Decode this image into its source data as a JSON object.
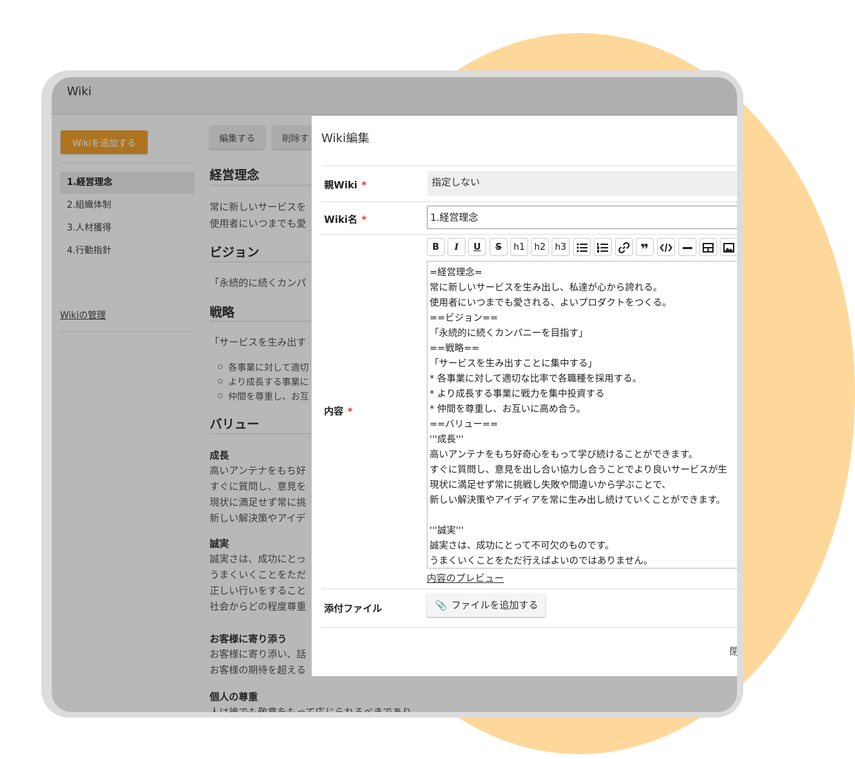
{
  "app": {
    "title": "Wiki"
  },
  "sidebar": {
    "add_label": "Wikiを追加する",
    "items": [
      {
        "label": "1.経営理念",
        "active": true
      },
      {
        "label": "2.組織体制",
        "active": false
      },
      {
        "label": "3.人材獲得",
        "active": false
      },
      {
        "label": "4.行動指針",
        "active": false
      }
    ],
    "manage_label": "Wikiの管理"
  },
  "page": {
    "edit_label": "編集する",
    "delete_label": "削除す",
    "sections": {
      "title": "経営理念",
      "intro": [
        "常に新しいサービスを",
        "使用者にいつまでも愛"
      ],
      "vision_heading": "ビジョン",
      "vision_text": "「永続的に続くカンパ",
      "strategy_heading": "戦略",
      "strategy_text": "「サービスを生み出す",
      "strategy_items": [
        "各事業に対して適切",
        "より成長する事業に",
        "仲間を尊重し、お互"
      ],
      "value_heading": "バリュー",
      "growth_title": "成長",
      "growth_lines": [
        "高いアンテナをもち好",
        "すぐに質問し、意見を",
        "現状に満足せず常に挑",
        "新しい解決策やアイデ"
      ],
      "integrity_title": "誠実",
      "integrity_lines": [
        "誠実さは、成功にとっ",
        "うまくいくことをただ",
        "正しい行いをすること",
        "社会からどの程度尊重"
      ],
      "customer_title": "お客様に寄り添う",
      "customer_lines": [
        "お客様に寄り添い、話",
        "お客様の期待を超える"
      ],
      "respect_title": "個人の尊重",
      "respect_line": "人は誰でも敬意をもって応じられるべきであり"
    }
  },
  "modal": {
    "title": "Wiki編集",
    "parent_label": "親Wiki",
    "parent_value": "指定しない",
    "name_label": "Wiki名",
    "name_value": "1.経営理念",
    "content_label": "内容",
    "required_mark": "*",
    "toolbar": [
      "B",
      "I",
      "U",
      "S",
      "h1",
      "h2",
      "h3",
      "ul",
      "ol",
      "link",
      "quote",
      "code",
      "hr",
      "table",
      "image"
    ],
    "editor_lines": [
      "=経営理念=",
      "常に新しいサービスを生み出し、私達が心から誇れる。",
      "使用者にいつまでも愛される、よいプロダクトをつくる。",
      "==ビジョン==",
      "「永続的に続くカンパニーを目指す」",
      "==戦略==",
      "「サービスを生み出すことに集中する」",
      "* 各事業に対して適切な比率で各職種を採用する。",
      "* より成長する事業に戦力を集中投資する",
      "* 仲間を尊重し、お互いに高め合う。",
      "==バリュー==",
      "'''成長'''",
      "高いアンテナをもち好奇心をもって学び続けることができます。",
      "すぐに質問し、意見を出し合い協力し合うことでより良いサービスが生",
      "現状に満足せず常に挑戦し失敗や間違いから学ぶことで、",
      "新しい解決策やアイディアを常に生み出し続けていくことができます。",
      "",
      "'''誠実'''",
      "誠実さは、成功にとって不可欠のものです。",
      "うまくいくことをただ行えばよいのではありません。"
    ],
    "preview_label": "内容のプレビュー",
    "attach_label": "添付ファイル",
    "attach_button": "ファイルを追加する",
    "close_label": "閉"
  },
  "colors": {
    "accent": "#f0a02a",
    "blob": "#fed89b",
    "required": "#e53935"
  }
}
